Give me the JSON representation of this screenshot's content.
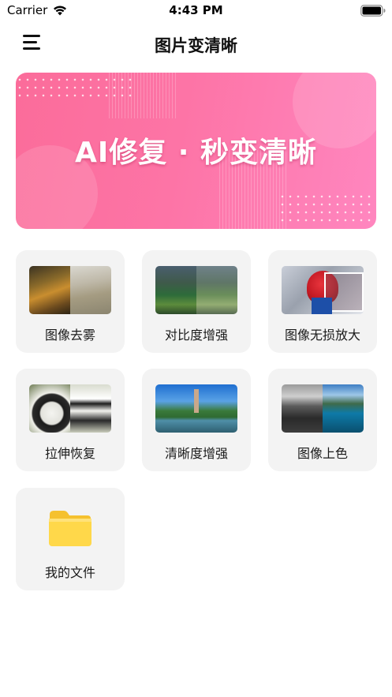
{
  "status_bar": {
    "carrier": "Carrier",
    "time": "4:43 PM"
  },
  "header": {
    "title": "图片变清晰",
    "menu_icon": "hamburger-menu-icon"
  },
  "banner": {
    "text": "AI修复 · 秒变清晰",
    "gradient": [
      "#fb6c9a",
      "#ff86bf"
    ]
  },
  "tools": [
    {
      "label": "图像去雾",
      "image": "dehaze-thumbnail"
    },
    {
      "label": "对比度增强",
      "image": "contrast-thumbnail"
    },
    {
      "label": "图像无损放大",
      "image": "upscale-thumbnail"
    },
    {
      "label": "拉伸恢复",
      "image": "stretch-restore-thumbnail"
    },
    {
      "label": "清晰度增强",
      "image": "sharpen-thumbnail"
    },
    {
      "label": "图像上色",
      "image": "colorize-thumbnail"
    },
    {
      "label": "我的文件",
      "image": "folder-icon"
    }
  ],
  "colors": {
    "card_background": "#f3f3f3",
    "folder": "#ffd84a",
    "text": "#1a1a1a"
  }
}
